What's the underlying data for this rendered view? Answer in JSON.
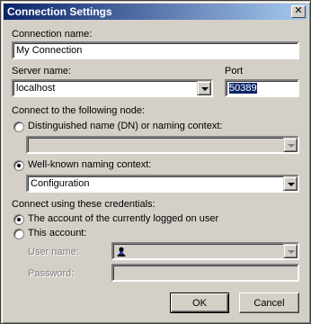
{
  "window": {
    "title": "Connection Settings",
    "close_glyph": "✕"
  },
  "connection": {
    "label": "Connection name:",
    "value": "My Connection"
  },
  "server": {
    "label": "Server name:",
    "value": "localhost"
  },
  "port": {
    "label": "Port",
    "value": "50389"
  },
  "node": {
    "heading": "Connect to the following node:",
    "dn_label": "Distinguished name (DN) or naming context:",
    "dn_value": "",
    "wellknown_label": "Well-known naming context:",
    "wellknown_value": "Configuration",
    "selected": "wellknown"
  },
  "credentials": {
    "heading": "Connect using these credentials:",
    "current_user_label": "The account of the currently logged on user",
    "this_account_label": "This account:",
    "username_label": "User name:",
    "password_label": "Password:",
    "selected": "current_user"
  },
  "buttons": {
    "ok": "OK",
    "cancel": "Cancel"
  },
  "colors": {
    "face": "#d4d0c8",
    "title_start": "#0a246a",
    "title_end": "#a6caf0",
    "selection": "#0a246a"
  },
  "icons": {
    "close": "close-icon",
    "dropdown": "chevron-down-icon",
    "user": "user-icon"
  }
}
